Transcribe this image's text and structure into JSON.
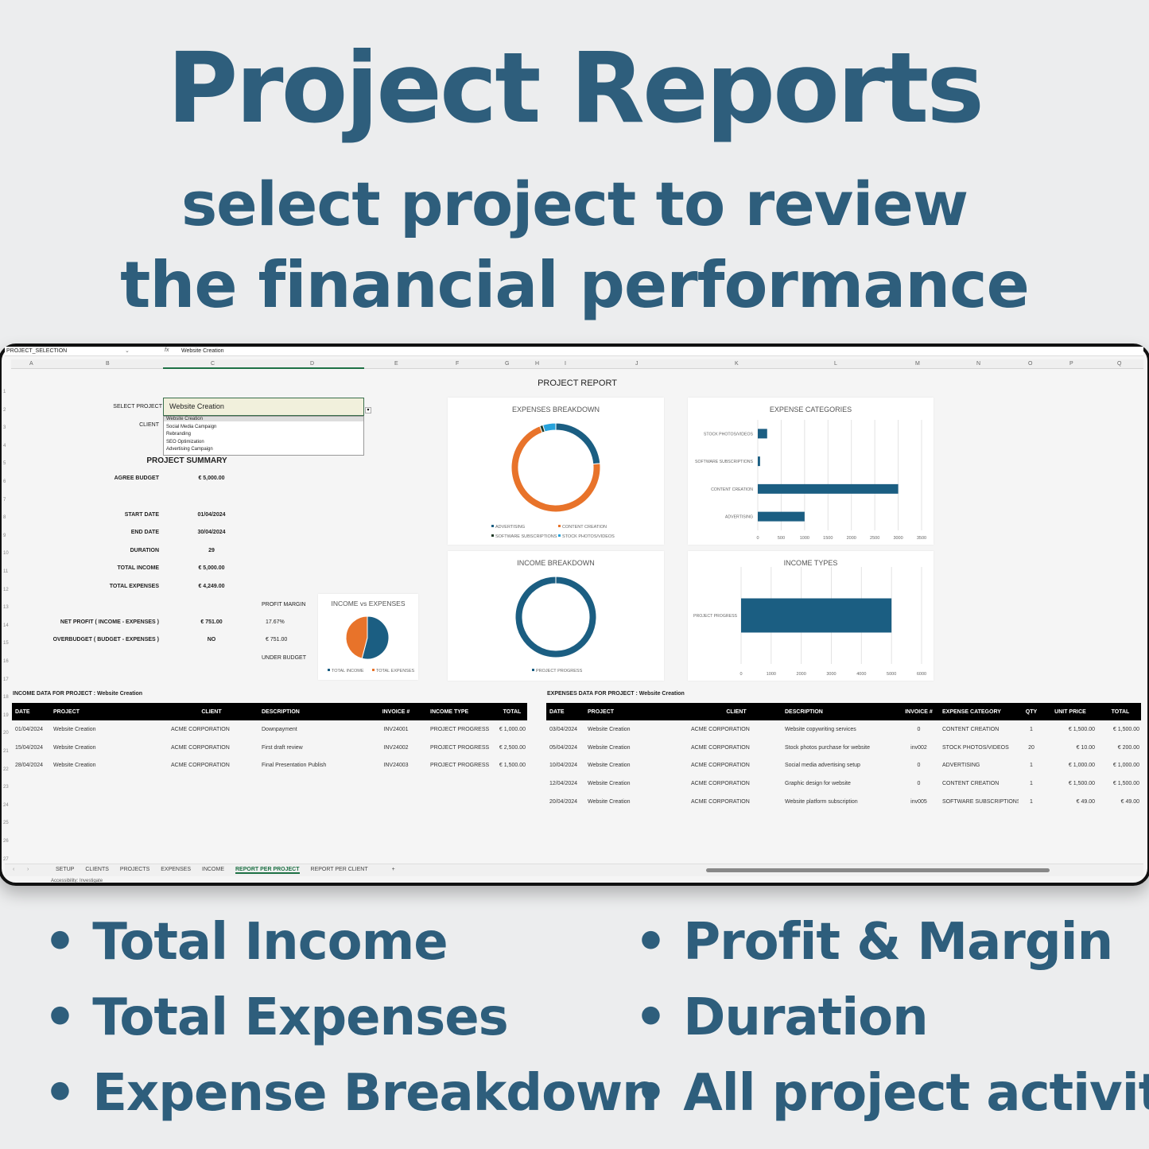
{
  "hero": {
    "title": "Project Reports",
    "subtitle_line1": "select project to review",
    "subtitle_line2": "the financial performance"
  },
  "features": [
    "Total Income",
    "Total Expenses",
    "Expense Breakdown",
    "Profit & Margin",
    "Duration",
    "All project activity"
  ],
  "excel": {
    "name_box": "PROJECT_SELECTION",
    "formula_value": "Website Creation",
    "fx_icon": "fx",
    "columns": [
      "A",
      "B",
      "C",
      "D",
      "E",
      "F",
      "G",
      "H",
      "I",
      "J",
      "K",
      "L",
      "M",
      "N",
      "O",
      "P",
      "Q"
    ],
    "rows": [
      "1",
      "2",
      "3",
      "4",
      "5",
      "6",
      "7",
      "8",
      "9",
      "10",
      "11",
      "12",
      "13",
      "14",
      "15",
      "16",
      "17",
      "18",
      "19",
      "20",
      "21",
      "22",
      "23",
      "24",
      "25",
      "26",
      "27"
    ],
    "sheet_tabs": [
      "SETUP",
      "CLIENTS",
      "PROJECTS",
      "EXPENSES",
      "INCOME",
      "REPORT PER PROJECT",
      "REPORT PER CLIENT"
    ],
    "active_tab": "REPORT PER PROJECT",
    "add_sheet": "+",
    "status_text": "Accessibility: Investigate"
  },
  "report": {
    "title": "PROJECT REPORT",
    "select_label": "SELECT PROJECT",
    "selected_project": "Website Creation",
    "client_label": "CLIENT",
    "dropdown_options": [
      "Website Creation",
      "Social Media Campaign",
      "Rebranding",
      "SEO Optimization",
      "Advertising Campaign"
    ],
    "summary_title": "PROJECT SUMMARY",
    "summary": [
      {
        "label": "AGREE BUDGET",
        "value": "€ 5,000.00"
      },
      {
        "label": "START DATE",
        "value": "01/04/2024"
      },
      {
        "label": "END DATE",
        "value": "30/04/2024"
      },
      {
        "label": "DURATION",
        "value": "29"
      },
      {
        "label": "TOTAL INCOME",
        "value": "€ 5,000.00"
      },
      {
        "label": "TOTAL EXPENSES",
        "value": "€ 4,249.00"
      },
      {
        "label": "NET PROFIT ( INCOME - EXPENSES )",
        "value": "€ 751.00"
      },
      {
        "label": "OVERBUDGET ( BUDGET - EXPENSES )",
        "value": "NO"
      }
    ],
    "profit_margin_label": "PROFIT MARGIN",
    "profit_margin": "17.67%",
    "under_budget_amount": "€ 751.00",
    "under_budget_label": "UNDER BUDGET"
  },
  "colors": {
    "blue": "#1b5e82",
    "orange": "#e8732a",
    "dark": "#1f3a26",
    "light_blue": "#27a3dc",
    "hero": "#2e5e7c"
  },
  "chart_data": [
    {
      "type": "pie",
      "title": "INCOME vs EXPENSES",
      "categories": [
        "TOTAL INCOME",
        "TOTAL EXPENSES"
      ],
      "values": [
        5000,
        4249
      ],
      "colors": [
        "#1b5e82",
        "#e8732a"
      ],
      "legend": "bottom"
    },
    {
      "type": "pie",
      "title": "EXPENSES BREAKDOWN",
      "donut": true,
      "categories": [
        "ADVERTISING",
        "CONTENT CREATION",
        "SOFTWARE SUBSCRIPTIONS",
        "STOCK PHOTOS/VIDEOS"
      ],
      "values": [
        1000,
        3000,
        49,
        200
      ],
      "colors": [
        "#1b5e82",
        "#e8732a",
        "#1f3a26",
        "#27a3dc"
      ],
      "legend": "bottom"
    },
    {
      "type": "bar",
      "orientation": "horizontal",
      "title": "EXPENSE CATEGORIES",
      "categories": [
        "STOCK PHOTOS/VIDEOS",
        "SOFTWARE SUBSCRIPTIONS",
        "CONTENT CREATION",
        "ADVERTISING"
      ],
      "values": [
        200,
        49,
        3000,
        1000
      ],
      "xlim": [
        0,
        3500
      ],
      "ticks": [
        "0",
        "500",
        "1000",
        "1500",
        "2000",
        "2500",
        "3000",
        "3500"
      ],
      "grid": true,
      "color": "#1b5e82"
    },
    {
      "type": "pie",
      "title": "INCOME BREAKDOWN",
      "donut": true,
      "categories": [
        "PROJECT PROGRESS"
      ],
      "values": [
        5000
      ],
      "colors": [
        "#1b5e82"
      ],
      "legend": "bottom"
    },
    {
      "type": "bar",
      "orientation": "horizontal",
      "title": "INCOME TYPES",
      "categories": [
        "PROJECT PROGRESS"
      ],
      "values": [
        5000
      ],
      "xlim": [
        0,
        6000
      ],
      "ticks": [
        "0",
        "1000",
        "2000",
        "3000",
        "4000",
        "5000",
        "6000"
      ],
      "grid": true,
      "color": "#1b5e82"
    }
  ],
  "income_table": {
    "title": "INCOME DATA FOR PROJECT :  Website Creation",
    "headers": [
      "DATE",
      "PROJECT",
      "CLIENT",
      "DESCRIPTION",
      "INVOICE #",
      "INCOME TYPE",
      "TOTAL"
    ],
    "rows": [
      [
        "01/04/2024",
        "Website Creation",
        "ACME CORPORATION",
        "Downpayment",
        "INV24001",
        "PROJECT PROGRESS",
        "€ 1,000.00"
      ],
      [
        "15/04/2024",
        "Website Creation",
        "ACME CORPORATION",
        "First draft review",
        "INV24002",
        "PROJECT PROGRESS",
        "€ 2,500.00"
      ],
      [
        "28/04/2024",
        "Website Creation",
        "ACME CORPORATION",
        "Final Presentation Publish",
        "INV24003",
        "PROJECT PROGRESS",
        "€ 1,500.00"
      ]
    ]
  },
  "expense_table": {
    "title": "EXPENSES DATA FOR PROJECT : Website Creation",
    "headers": [
      "DATE",
      "PROJECT",
      "CLIENT",
      "DESCRIPTION",
      "INVOICE #",
      "EXPENSE CATEGORY",
      "QTY",
      "UNIT PRICE",
      "TOTAL"
    ],
    "rows": [
      [
        "03/04/2024",
        "Website Creation",
        "ACME CORPORATION",
        "Website copywriting services",
        "0",
        "CONTENT CREATION",
        "1",
        "€ 1,500.00",
        "€ 1,500.00"
      ],
      [
        "05/04/2024",
        "Website Creation",
        "ACME CORPORATION",
        "Stock photos purchase for website",
        "inv002",
        "STOCK PHOTOS/VIDEOS",
        "20",
        "€ 10.00",
        "€ 200.00"
      ],
      [
        "10/04/2024",
        "Website Creation",
        "ACME CORPORATION",
        "Social media advertising setup",
        "0",
        "ADVERTISING",
        "1",
        "€ 1,000.00",
        "€ 1,000.00"
      ],
      [
        "12/04/2024",
        "Website Creation",
        "ACME CORPORATION",
        "Graphic design for website",
        "0",
        "CONTENT CREATION",
        "1",
        "€ 1,500.00",
        "€ 1,500.00"
      ],
      [
        "20/04/2024",
        "Website Creation",
        "ACME CORPORATION",
        "Website platform subscription",
        "inv005",
        "SOFTWARE SUBSCRIPTIONS",
        "1",
        "€ 49.00",
        "€ 49.00"
      ]
    ]
  }
}
